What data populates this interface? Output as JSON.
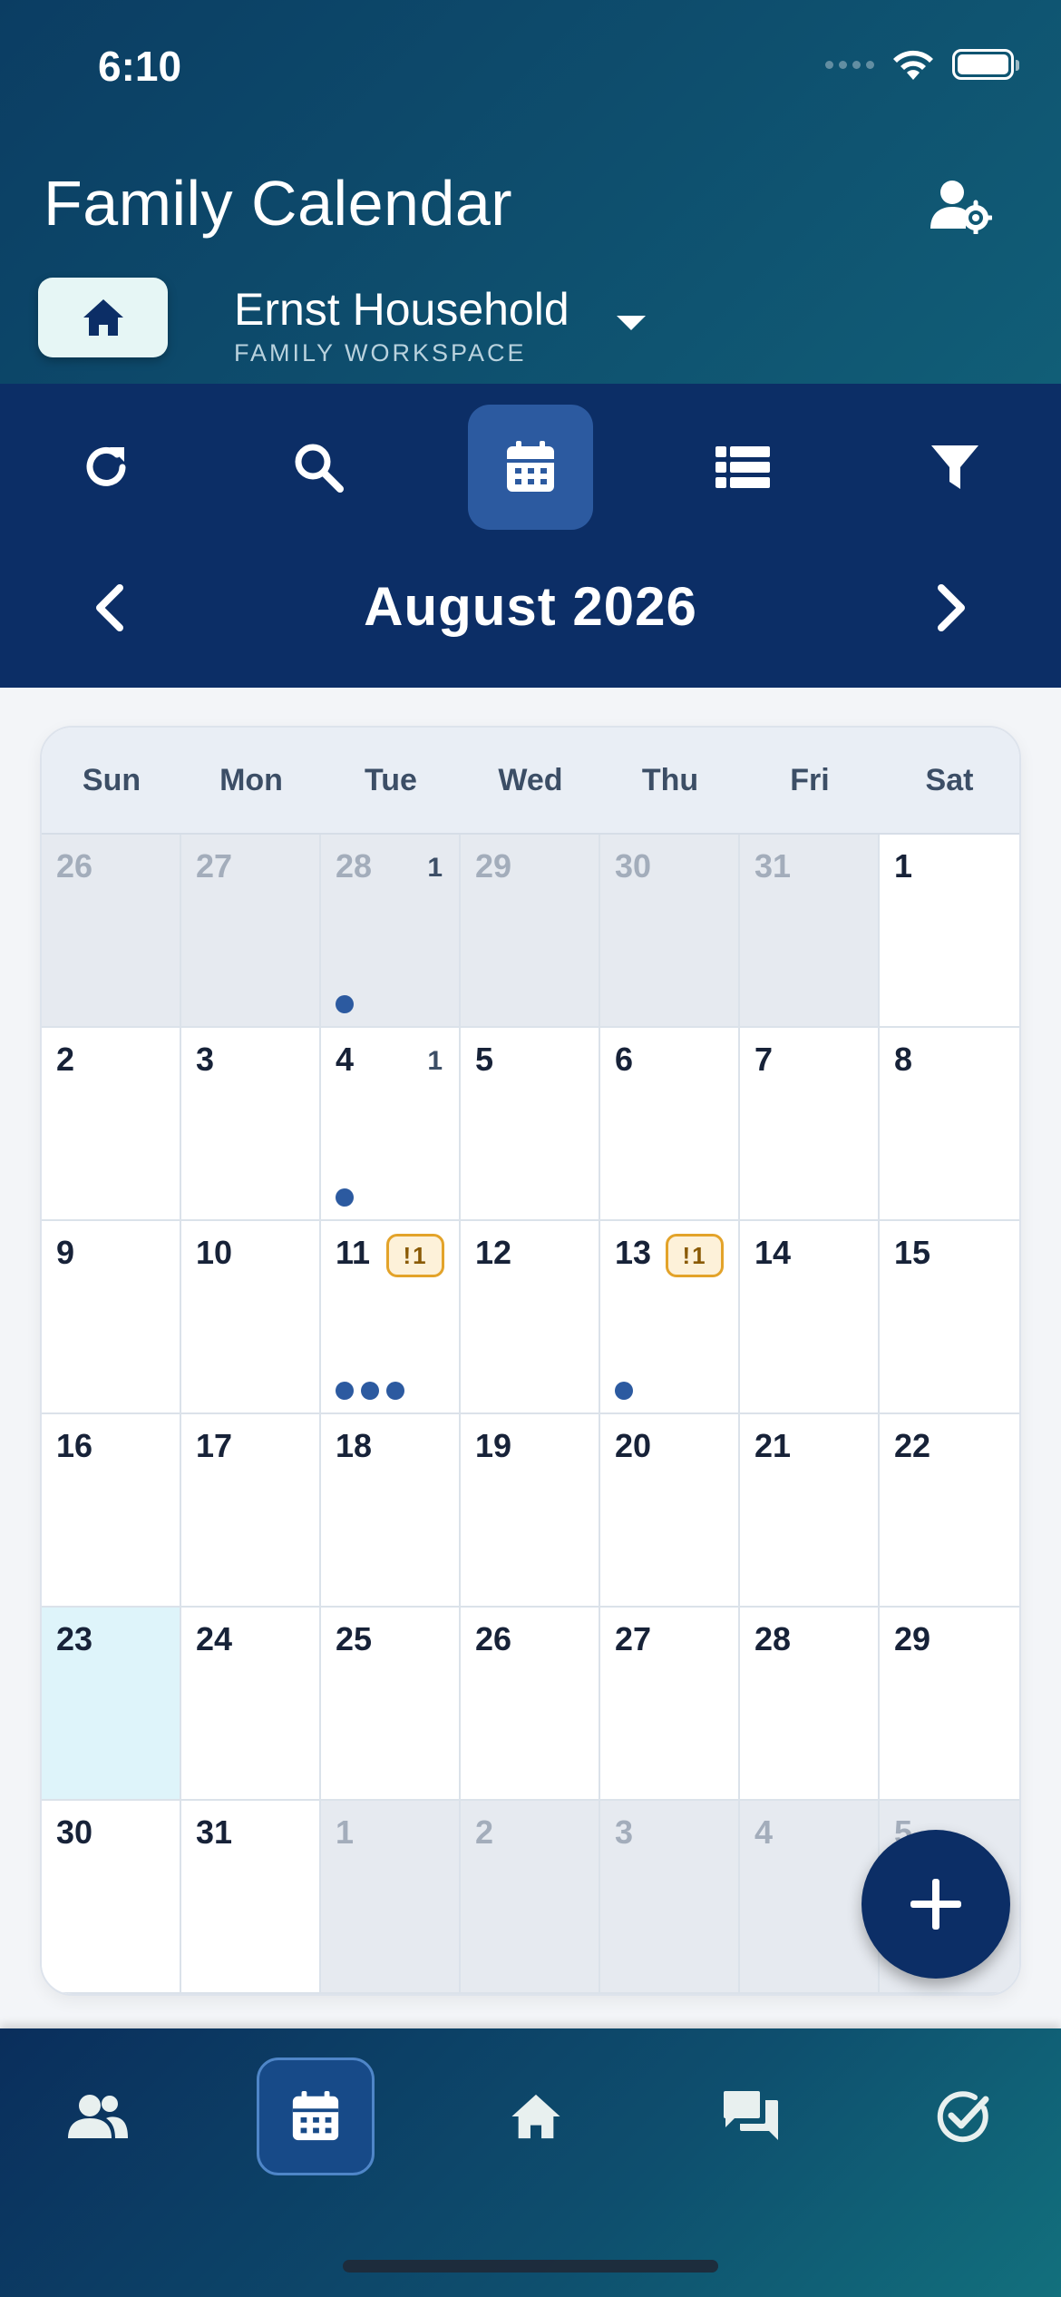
{
  "status": {
    "time": "6:10"
  },
  "header": {
    "title": "Family Calendar",
    "workspace_name": "Ernst Household",
    "workspace_sub": "FAMILY WORKSPACE"
  },
  "toolbar": {
    "active": "calendar",
    "tools": [
      "refresh-icon",
      "search-icon",
      "calendar-icon",
      "list-icon",
      "filter-icon"
    ]
  },
  "month": {
    "label": "August 2026"
  },
  "calendar": {
    "weekdays": [
      "Sun",
      "Mon",
      "Tue",
      "Wed",
      "Thu",
      "Fri",
      "Sat"
    ],
    "days": [
      {
        "n": "26",
        "m": true
      },
      {
        "n": "27",
        "m": true
      },
      {
        "n": "28",
        "m": true,
        "count": "1",
        "dots": 1
      },
      {
        "n": "29",
        "m": true
      },
      {
        "n": "30",
        "m": true
      },
      {
        "n": "31",
        "m": true
      },
      {
        "n": "1"
      },
      {
        "n": "2"
      },
      {
        "n": "3"
      },
      {
        "n": "4",
        "count": "1",
        "dots": 1
      },
      {
        "n": "5"
      },
      {
        "n": "6"
      },
      {
        "n": "7"
      },
      {
        "n": "8"
      },
      {
        "n": "9"
      },
      {
        "n": "10"
      },
      {
        "n": "11",
        "badge": "!1",
        "dots": 3
      },
      {
        "n": "12"
      },
      {
        "n": "13",
        "badge": "!1",
        "dots": 1
      },
      {
        "n": "14"
      },
      {
        "n": "15"
      },
      {
        "n": "16"
      },
      {
        "n": "17"
      },
      {
        "n": "18"
      },
      {
        "n": "19"
      },
      {
        "n": "20"
      },
      {
        "n": "21"
      },
      {
        "n": "22"
      },
      {
        "n": "23",
        "today": true
      },
      {
        "n": "24"
      },
      {
        "n": "25"
      },
      {
        "n": "26"
      },
      {
        "n": "27"
      },
      {
        "n": "28"
      },
      {
        "n": "29"
      },
      {
        "n": "30"
      },
      {
        "n": "31"
      },
      {
        "n": "1",
        "m": true
      },
      {
        "n": "2",
        "m": true
      },
      {
        "n": "3",
        "m": true
      },
      {
        "n": "4",
        "m": true
      },
      {
        "n": "5",
        "m": true
      }
    ]
  },
  "bottom_nav": {
    "active": "calendar",
    "tabs": [
      "people-icon",
      "calendar-icon",
      "home-icon",
      "chat-icon",
      "check-icon"
    ]
  }
}
